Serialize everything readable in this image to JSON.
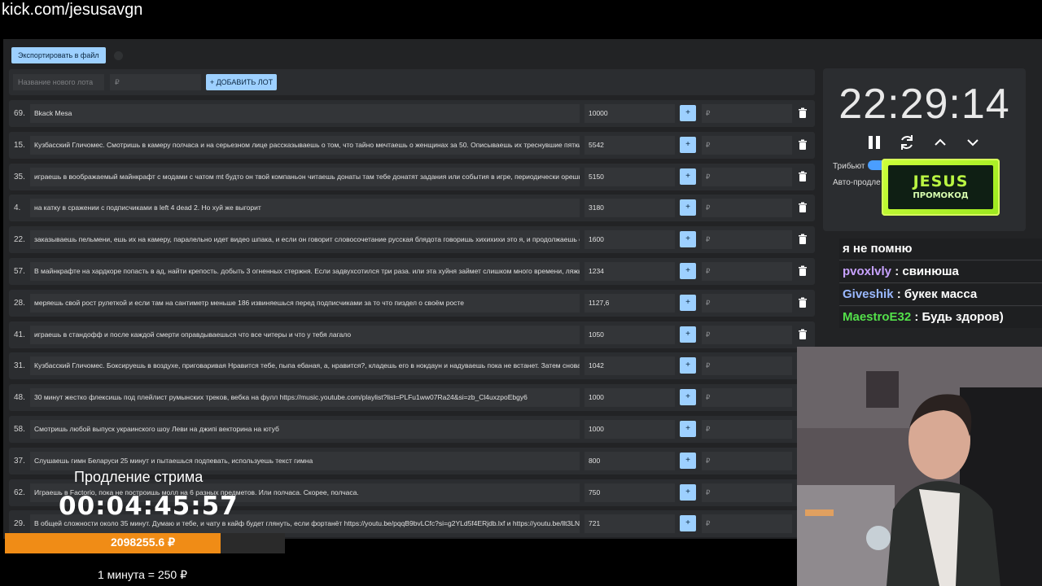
{
  "browser": {
    "url": "kick.com/jesusavgn"
  },
  "toolbar": {
    "export_label": "Экспортировать в файл"
  },
  "add_lot": {
    "name_placeholder": "Название нового лота",
    "price_placeholder": "₽",
    "add_button_label": "+ ДОБАВИТЬ ЛОТ"
  },
  "lots": [
    {
      "rank": "69.",
      "title": "Bkack Mesa",
      "amount": "10000",
      "plus": "+",
      "add_placeholder": "₽"
    },
    {
      "rank": "15.",
      "title": "Кузбасский Гличомес. Смотришь в камеру полчаса и на серьезном лице рассказываешь о том, что тайно мечтаешь о женщинах за 50. Описываешь их треснувшие пятки и",
      "amount": "5542",
      "plus": "+",
      "add_placeholder": "₽"
    },
    {
      "rank": "35.",
      "title": "играешь в воображаемый майнкрафт с модами с чатом mt будто он твой компаньон читаешь донаты там тебе донатят задания или события в игре, периодически орешь в",
      "amount": "5150",
      "plus": "+",
      "add_placeholder": "₽"
    },
    {
      "rank": "4.",
      "title": "на катку в сражении с подписчиками в left 4 dead 2. Но хуй же выгорит",
      "amount": "3180",
      "plus": "+",
      "add_placeholder": "₽"
    },
    {
      "rank": "22.",
      "title": "заказываешь пельмени, ешь их на камеру, паралельно идет видео шпака, и если он говорит словосочетание русская блядота говоришь хихихихи это я, и продолжаешь ес",
      "amount": "1600",
      "plus": "+",
      "add_placeholder": "₽"
    },
    {
      "rank": "57.",
      "title": "В майнкрафте на хардкоре попасть в ад, найти крепость. добыть 3 огненных стержня. Если задвухсотился три раза. или эта хуйня займет слишком много времени, ляжь н",
      "amount": "1234",
      "plus": "+",
      "add_placeholder": "₽"
    },
    {
      "rank": "28.",
      "title": "меряешь свой рост рулеткой и если там на сантиметр меньше 186 извиняешься перед подписчиками за то что пиздел о своём росте",
      "amount": "1127,6",
      "plus": "+",
      "add_placeholder": "₽"
    },
    {
      "rank": "41.",
      "title": "играешь в стандофф и после каждой смерти оправдываешься что все читеры и что у тебя лагало",
      "amount": "1050",
      "plus": "+",
      "add_placeholder": "₽"
    },
    {
      "rank": "31.",
      "title": "Кузбасский Гличомес. Боксируешь в воздухе, приговаривая Нравится тебе, пыпа ебаная, а, нравится?, кладешь его в нокдаун и надуваешь пока не встанет. Затем снова х",
      "amount": "1042",
      "plus": "+",
      "add_placeholder": "₽"
    },
    {
      "rank": "48.",
      "title": "30 минут жестко флексишь под плейлист румынских треков, вебка на фулл https://music.youtube.com/playlist?list=PLFu1ww07Ra24&si=zb_Cl4uxzpoEbgy6",
      "amount": "1000",
      "plus": "+",
      "add_placeholder": "₽"
    },
    {
      "rank": "58.",
      "title": "Смотришь любой выпуск украинского шоу Леви на джипі векторина на ютуб",
      "amount": "1000",
      "plus": "+",
      "add_placeholder": "₽"
    },
    {
      "rank": "37.",
      "title": "Слушаешь гимн Беларуси 25 минут и пытаешься подпевать, используешь текст гимна",
      "amount": "800",
      "plus": "+",
      "add_placeholder": "₽"
    },
    {
      "rank": "62.",
      "title": "Играешь в Factorio, пока не построишь молл на 6 разных предметов. Или полчаса. Скорее, полчаса.",
      "amount": "750",
      "plus": "+",
      "add_placeholder": "₽"
    },
    {
      "rank": "29.",
      "title": "В общей сложности около 35 минут. Думаю и тебе, и чату в кайф будет глянуть, если фортанёт https://youtu.be/pqqB9bvLCfc?si=g2YLd5f4ERjdb.lxf и https://youtu.be/llt3LNT(",
      "amount": "721",
      "plus": "+",
      "add_placeholder": "₽"
    }
  ],
  "timer": {
    "display": "22:29:14",
    "tribute_label": "Трибьют",
    "auto_label": "Авто-продле"
  },
  "promo": {
    "brand": "JESUS",
    "subtitle": "ПРОМОКОД",
    "accent": "#b9f542"
  },
  "chat": [
    {
      "user": "",
      "text": "я не помню",
      "color": "#ffffff"
    },
    {
      "user": "pvoxlvly",
      "text": " : свинюша",
      "color": "#c8a2ff"
    },
    {
      "user": "Giveshik",
      "text": " : букек масса",
      "color": "#9ab8ff"
    },
    {
      "user": "MaestroE32",
      "text": " : Будь здоров)",
      "color": "#53e04a"
    }
  ],
  "overlay": {
    "extension_label": "Продление стрима",
    "extension_timer": "00:04:45:57",
    "total_amount": "2098255.6 ₽",
    "progress_fraction": 0.77,
    "progress_color": "#f08c16",
    "rate": "1 минута = 250 ₽"
  }
}
